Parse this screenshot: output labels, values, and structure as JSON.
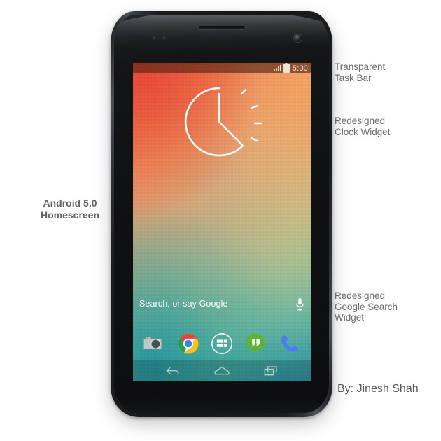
{
  "annotations": {
    "left_label": "Android 5.0\nHomescreen",
    "taskbar": "Transparent\nTask Bar",
    "clock": "Redesigned\nClock Widget",
    "search": "Redesigned\nGoogle Search\nWidget",
    "byline": "By: Jinesh Shah"
  },
  "phone": {
    "status_bar": {
      "time": "5:00",
      "signal_icon": "signal-bars-icon",
      "battery_icon": "battery-icon",
      "background_color": "#542414"
    },
    "clock_widget": {
      "icon": "analog-clock-icon",
      "stroke_color": "#ffffff",
      "hour_hand_angle_deg": 0,
      "minute_hand_angle_deg": 125
    },
    "search_widget": {
      "placeholder": "Search, or say Google",
      "mic_icon": "microphone-icon",
      "text_color": "#ffffff"
    },
    "dock": [
      {
        "name": "camera",
        "icon": "camera-icon",
        "color": "#b5b7b8"
      },
      {
        "name": "chrome",
        "icon": "chrome-icon",
        "color": "#4285f4"
      },
      {
        "name": "app-drawer",
        "icon": "app-drawer-icon",
        "color": "#ffffff"
      },
      {
        "name": "hangouts",
        "icon": "hangouts-icon",
        "color": "#5cb531"
      },
      {
        "name": "phone",
        "icon": "phone-handset-icon",
        "color": "#4a7ef0"
      }
    ],
    "navigation": [
      {
        "name": "back",
        "icon": "back-arrow-icon"
      },
      {
        "name": "home",
        "icon": "home-dome-icon"
      },
      {
        "name": "recents",
        "icon": "recent-apps-icon"
      }
    ],
    "wallpaper": {
      "top_left_color": "#ef5a43",
      "top_right_color": "#f8a860",
      "middle_color": "#b7b08c",
      "bottom_color": "#2f95a4"
    },
    "hardware": {
      "earpiece": "earpiece-speaker",
      "front_camera": "front-camera-icon",
      "sensors": "proximity-sensor",
      "body_color": "#151618"
    }
  }
}
